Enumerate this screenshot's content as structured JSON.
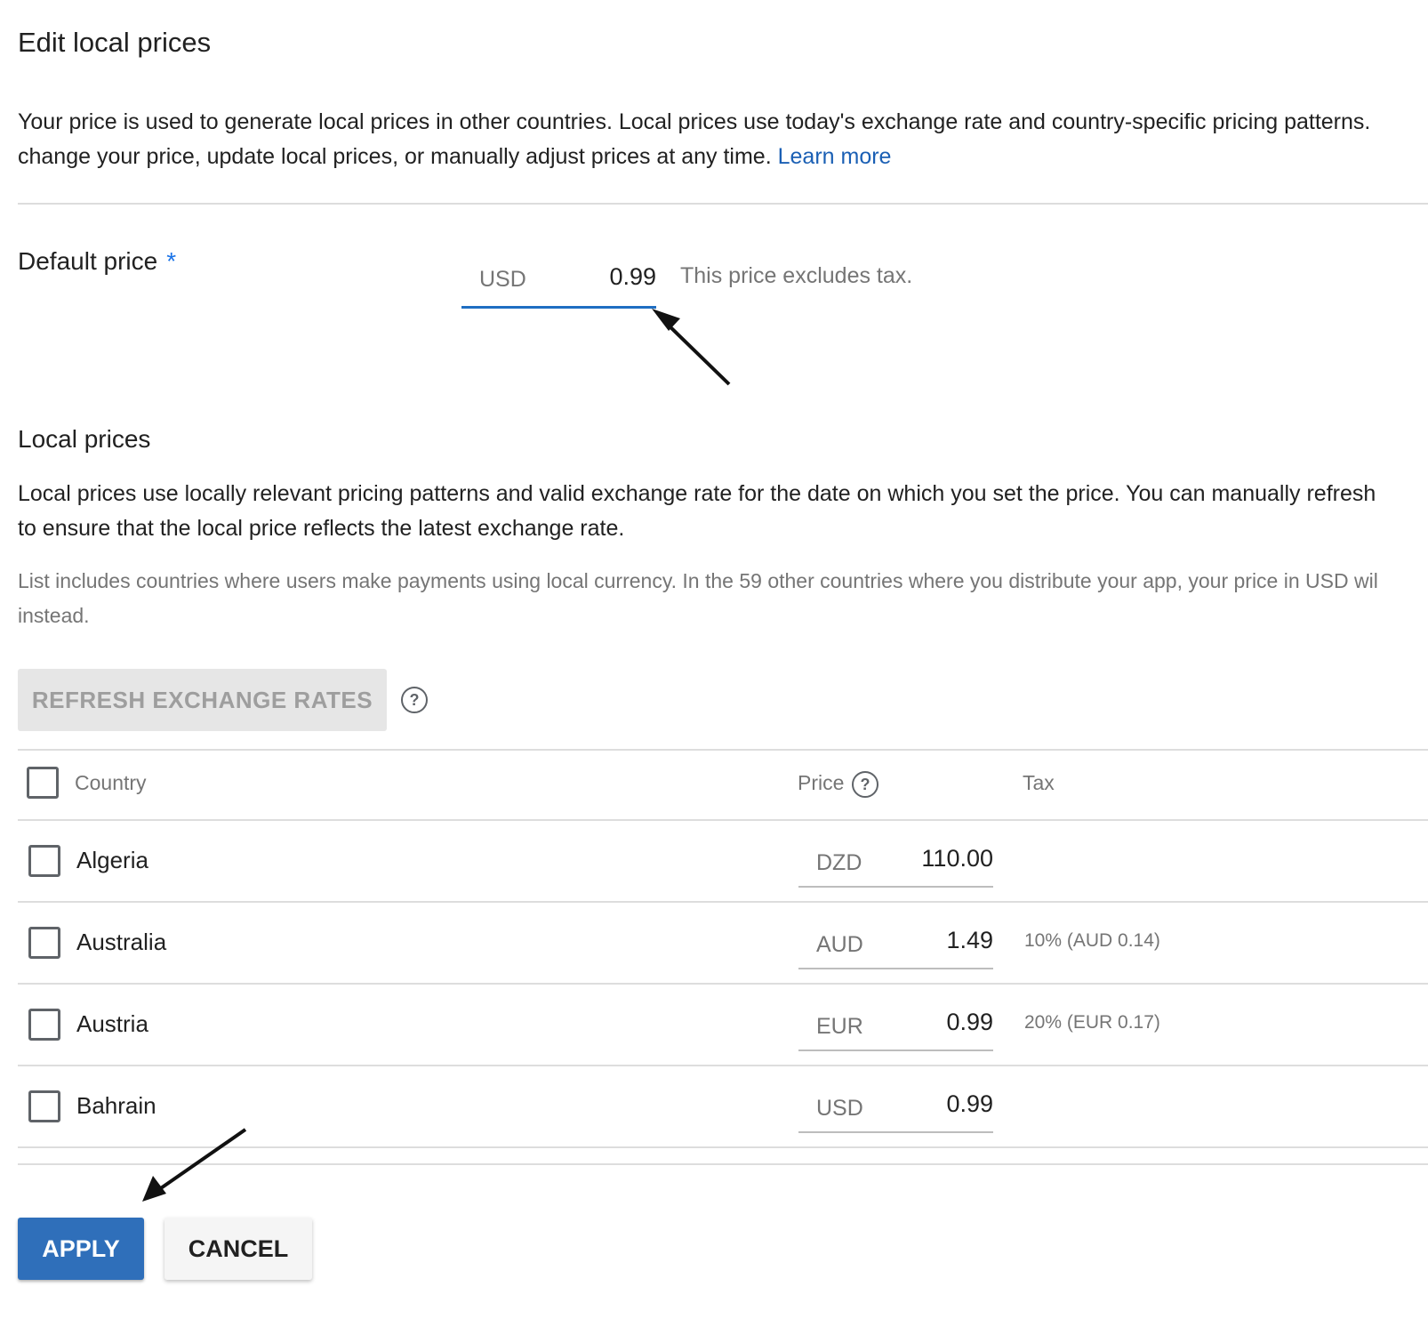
{
  "dialog": {
    "title": "Edit local prices",
    "intro_line1": "Your price is used to generate local prices in other countries. Local prices use today's exchange rate and country-specific pricing patterns.",
    "intro_line2": "change your price, update local prices, or manually adjust prices at any time.",
    "learn_more": "Learn more"
  },
  "default_price": {
    "label": "Default price",
    "required_marker": "*",
    "currency": "USD",
    "value": "0.99",
    "note": "This price excludes tax."
  },
  "local_prices": {
    "title": "Local prices",
    "desc_line1": "Local prices use locally relevant pricing patterns and valid exchange rate for the date on which you set the price. You can manually refresh",
    "desc_line2": "to ensure that the local price reflects the latest exchange rate.",
    "note_line1": "List includes countries where users make payments using local currency. In the 59 other countries where you distribute your app, your price in USD wil",
    "note_line2": "instead.",
    "refresh_button": "REFRESH EXCHANGE RATES",
    "help_glyph": "?"
  },
  "table": {
    "headers": {
      "country": "Country",
      "price": "Price",
      "tax": "Tax"
    },
    "rows": [
      {
        "country": "Algeria",
        "currency": "DZD",
        "price": "110.00",
        "tax": ""
      },
      {
        "country": "Australia",
        "currency": "AUD",
        "price": "1.49",
        "tax": "10% (AUD 0.14)"
      },
      {
        "country": "Austria",
        "currency": "EUR",
        "price": "0.99",
        "tax": "20% (EUR 0.17)"
      },
      {
        "country": "Bahrain",
        "currency": "USD",
        "price": "0.99",
        "tax": ""
      }
    ]
  },
  "actions": {
    "apply": "APPLY",
    "cancel": "CANCEL"
  },
  "colors": {
    "accent": "#2f6fba",
    "link": "#1a5fb4",
    "divider": "#dddddd"
  },
  "icons": {
    "help": "help-circle-icon",
    "checkbox": "checkbox-unchecked-icon",
    "annotation": "arrow-annotation-icon"
  }
}
